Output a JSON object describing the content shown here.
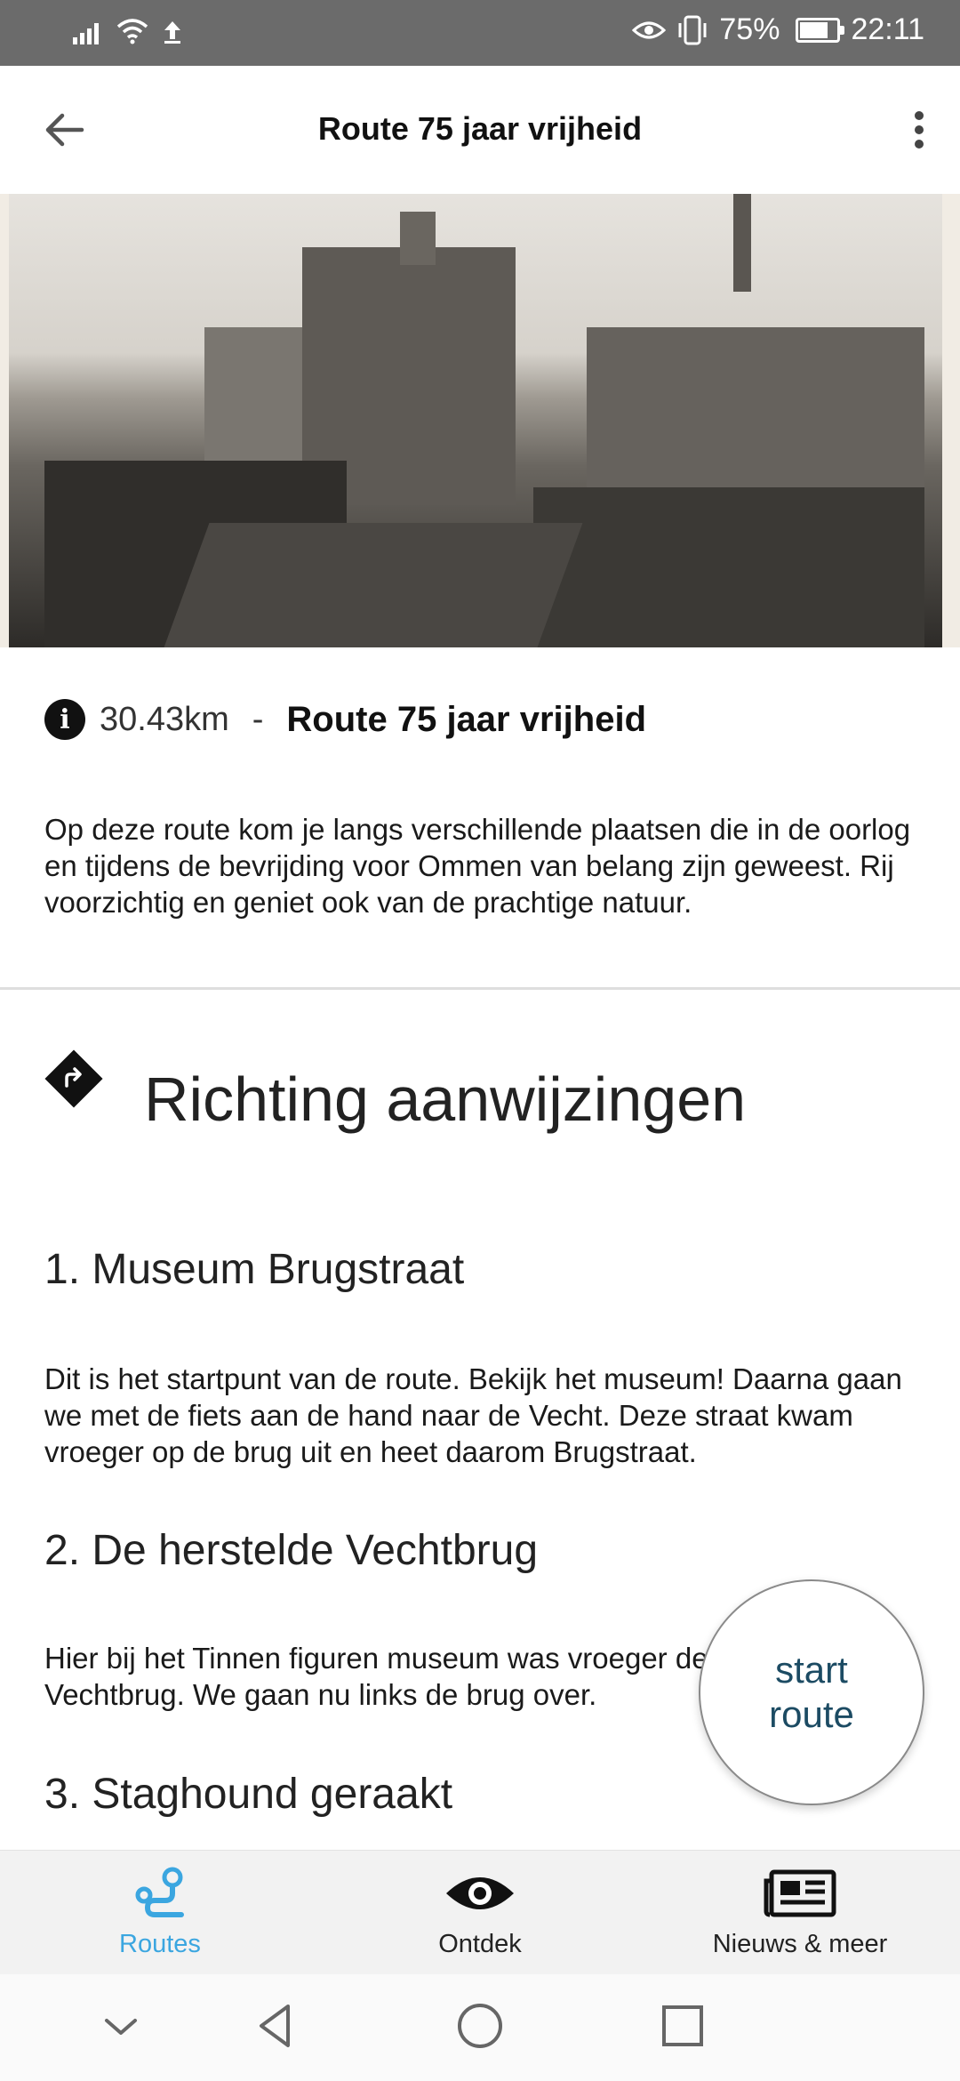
{
  "status_bar": {
    "battery": "75%",
    "time": "22:11"
  },
  "app_bar": {
    "title": "Route 75 jaar vrijheid"
  },
  "route_info": {
    "distance": "30.43km",
    "separator": "-",
    "name": "Route 75 jaar vrijheid",
    "description": "Op deze route kom je langs verschillende plaatsen die in de oorlog en tijdens de bevrijding voor Ommen van belang zijn geweest. Rij voorzichtig en geniet ook van de prachtige natuur."
  },
  "directions": {
    "title": "Richting aanwijzingen",
    "steps": [
      {
        "title": "1. Museum Brugstraat",
        "text": "Dit is het startpunt van de route. Bekijk het museum! Daarna gaan we met de fiets aan de hand naar de Vecht. Deze straat kwam vroeger op de brug uit en heet daarom Brugstraat."
      },
      {
        "title": "2. De herstelde Vechtbrug",
        "text": "Hier bij het Tinnen figuren museum was vroeger de Vechtbrug. We gaan nu links de brug over."
      },
      {
        "title": "3. Staghound geraakt",
        "text": ""
      }
    ]
  },
  "fab": {
    "line1": "start",
    "line2": "route"
  },
  "bottom_nav": {
    "items": [
      {
        "label": "Routes",
        "icon": "route-icon",
        "active": true
      },
      {
        "label": "Ontdek",
        "icon": "eye-icon",
        "active": false
      },
      {
        "label": "Nieuws & meer",
        "icon": "newspaper-icon",
        "active": false
      }
    ]
  },
  "colors": {
    "accent": "#3ba6e0",
    "fab_text": "#1c4b63",
    "status_bar": "#6b6b6b"
  }
}
